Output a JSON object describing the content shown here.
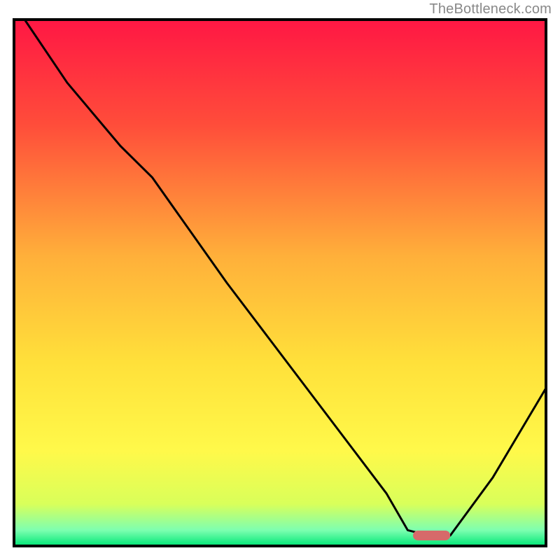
{
  "watermark": "TheBottleneck.com",
  "chart_data": {
    "type": "line",
    "title": "",
    "xlabel": "",
    "ylabel": "",
    "xlim": [
      0,
      100
    ],
    "ylim": [
      0,
      100
    ],
    "optimal_marker": {
      "x_start": 75,
      "x_end": 82,
      "y": 2
    },
    "series": [
      {
        "name": "bottleneck-curve",
        "x": [
          2,
          10,
          20,
          26,
          40,
          55,
          70,
          74,
          78,
          82,
          90,
          100
        ],
        "y": [
          100,
          88,
          76,
          70,
          50,
          30,
          10,
          3,
          2,
          2,
          13,
          30
        ]
      }
    ],
    "gradient_stops": [
      {
        "offset": 0,
        "color": "#ff1744"
      },
      {
        "offset": 20,
        "color": "#ff4d3a"
      },
      {
        "offset": 45,
        "color": "#ffb03a"
      },
      {
        "offset": 65,
        "color": "#ffe03a"
      },
      {
        "offset": 82,
        "color": "#fff94a"
      },
      {
        "offset": 92,
        "color": "#d9ff5a"
      },
      {
        "offset": 97,
        "color": "#7dffb0"
      },
      {
        "offset": 100,
        "color": "#00e676"
      }
    ],
    "border_color": "#000000",
    "curve_color": "#000000",
    "marker_color": "#d66a6a"
  }
}
